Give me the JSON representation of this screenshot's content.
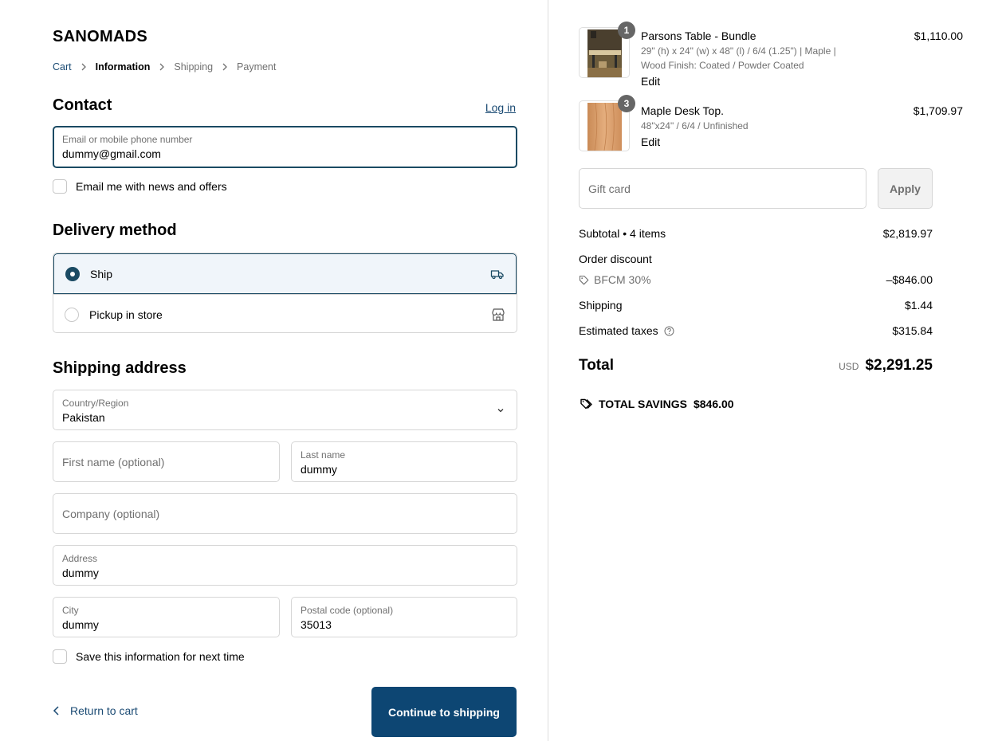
{
  "brand": "SANOMADS",
  "breadcrumbs": [
    "Cart",
    "Information",
    "Shipping",
    "Payment"
  ],
  "contact": {
    "title": "Contact",
    "login": "Log in",
    "email_label": "Email or mobile phone number",
    "email_value": "dummy@gmail.com",
    "news_label": "Email me with news and offers"
  },
  "delivery": {
    "title": "Delivery method",
    "options": [
      {
        "label": "Ship",
        "selected": true,
        "icon": "truck-icon"
      },
      {
        "label": "Pickup in store",
        "selected": false,
        "icon": "store-icon"
      }
    ]
  },
  "shipping": {
    "title": "Shipping address",
    "country_label": "Country/Region",
    "country_value": "Pakistan",
    "first_name_placeholder": "First name (optional)",
    "last_name_label": "Last name",
    "last_name_value": "dummy",
    "company_placeholder": "Company (optional)",
    "address_label": "Address",
    "address_value": "dummy",
    "city_label": "City",
    "city_value": "dummy",
    "postal_label": "Postal code (optional)",
    "postal_value": "35013",
    "save_label": "Save this information for next time"
  },
  "actions": {
    "return": "Return to cart",
    "continue": "Continue to shipping"
  },
  "summary": {
    "items": [
      {
        "qty": "1",
        "name": "Parsons Table - Bundle",
        "variant_lines": [
          "29\" (h) x 24\" (w) x 48\" (l) / 6/4 (1.25\") | Maple |",
          "Wood Finish: Coated / Powder Coated"
        ],
        "edit": "Edit",
        "price": "$1,110.00"
      },
      {
        "qty": "3",
        "name": "Maple Desk Top.",
        "variant_lines": [
          "48\"x24\" / 6/4 / Unfinished"
        ],
        "edit": "Edit",
        "price": "$1,709.97"
      }
    ],
    "gift_placeholder": "Gift card",
    "apply": "Apply",
    "subtotal_label": "Subtotal • 4 items",
    "subtotal_value": "$2,819.97",
    "order_discount_label": "Order discount",
    "discount_code": "BFCM 30%",
    "discount_value": "–$846.00",
    "shipping_label": "Shipping",
    "shipping_value": "$1.44",
    "taxes_label": "Estimated taxes",
    "taxes_value": "$315.84",
    "total_label": "Total",
    "currency": "USD",
    "total_value": "$2,291.25",
    "savings_label": "TOTAL SAVINGS",
    "savings_value": "$846.00"
  },
  "colors": {
    "accent": "#0d4673",
    "link": "#1a4a73",
    "selected_bg": "#f0f5fa"
  }
}
